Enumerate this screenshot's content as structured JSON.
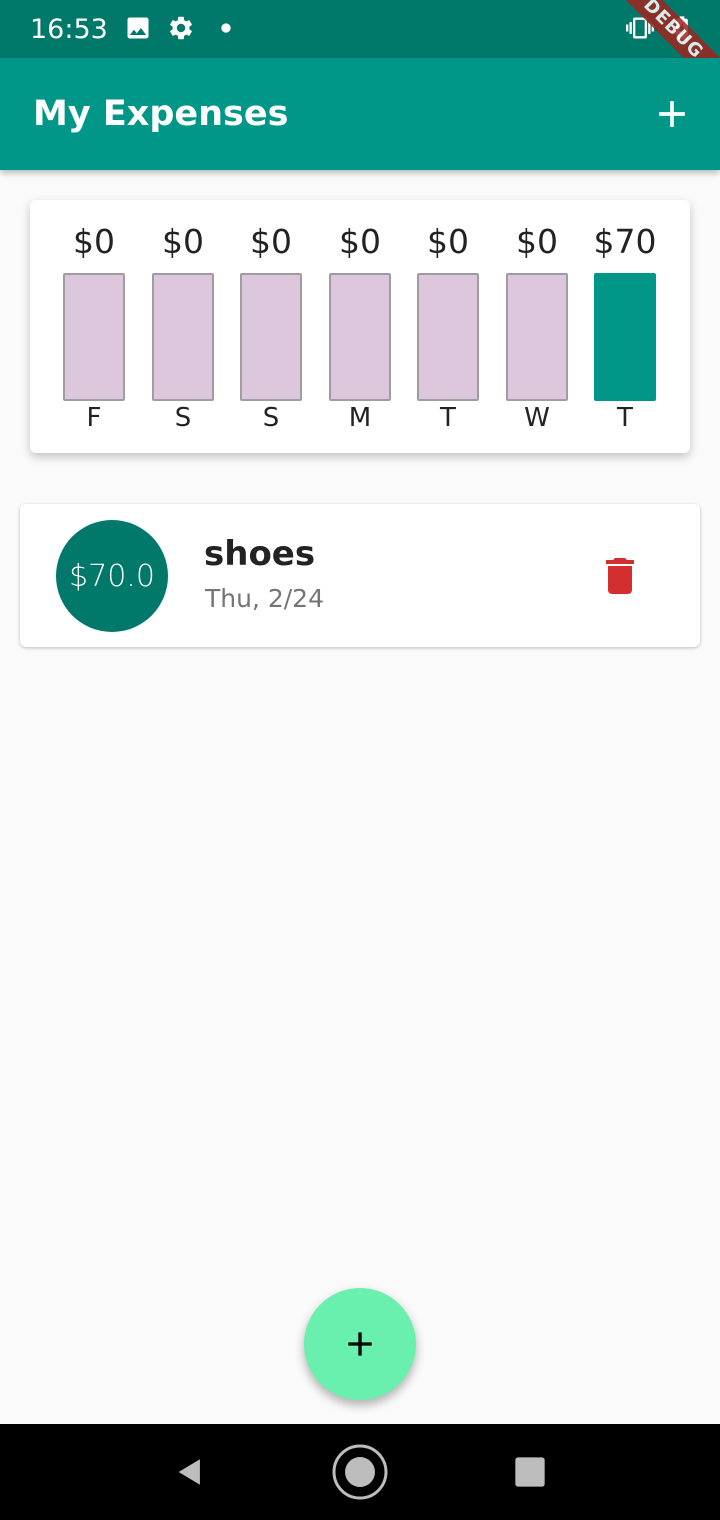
{
  "status_bar": {
    "time": "16:53",
    "debug_label": "DEBUG",
    "icons": [
      "image-icon",
      "gear-icon",
      "dot-icon",
      "vibrate-icon",
      "battery-charging-icon"
    ]
  },
  "app_bar": {
    "title": "My Expenses",
    "add_icon": "plus-icon"
  },
  "chart_data": {
    "type": "bar",
    "categories": [
      "F",
      "S",
      "S",
      "M",
      "T",
      "W",
      "T"
    ],
    "value_labels": [
      "$0",
      "$0",
      "$0",
      "$0",
      "$0",
      "$0",
      "$70"
    ],
    "values": [
      0,
      0,
      0,
      0,
      0,
      0,
      70
    ],
    "fill_fraction": [
      0,
      0,
      0,
      0,
      0,
      0,
      1.0
    ],
    "colors": {
      "track": "#dcc7dd",
      "fill": "#009688"
    }
  },
  "transactions": [
    {
      "amount": "$70.0",
      "title": "shoes",
      "date": "Thu, 2/24",
      "action_icon": "trash-icon"
    }
  ],
  "fab": {
    "icon": "plus-icon"
  },
  "nav_bar": {
    "icons": [
      "back-icon",
      "home-icon",
      "recents-icon"
    ]
  },
  "colors": {
    "primary": "#009688",
    "primary_dark": "#00796b",
    "accent": "#69f0ae",
    "delete": "#d32f2f"
  }
}
